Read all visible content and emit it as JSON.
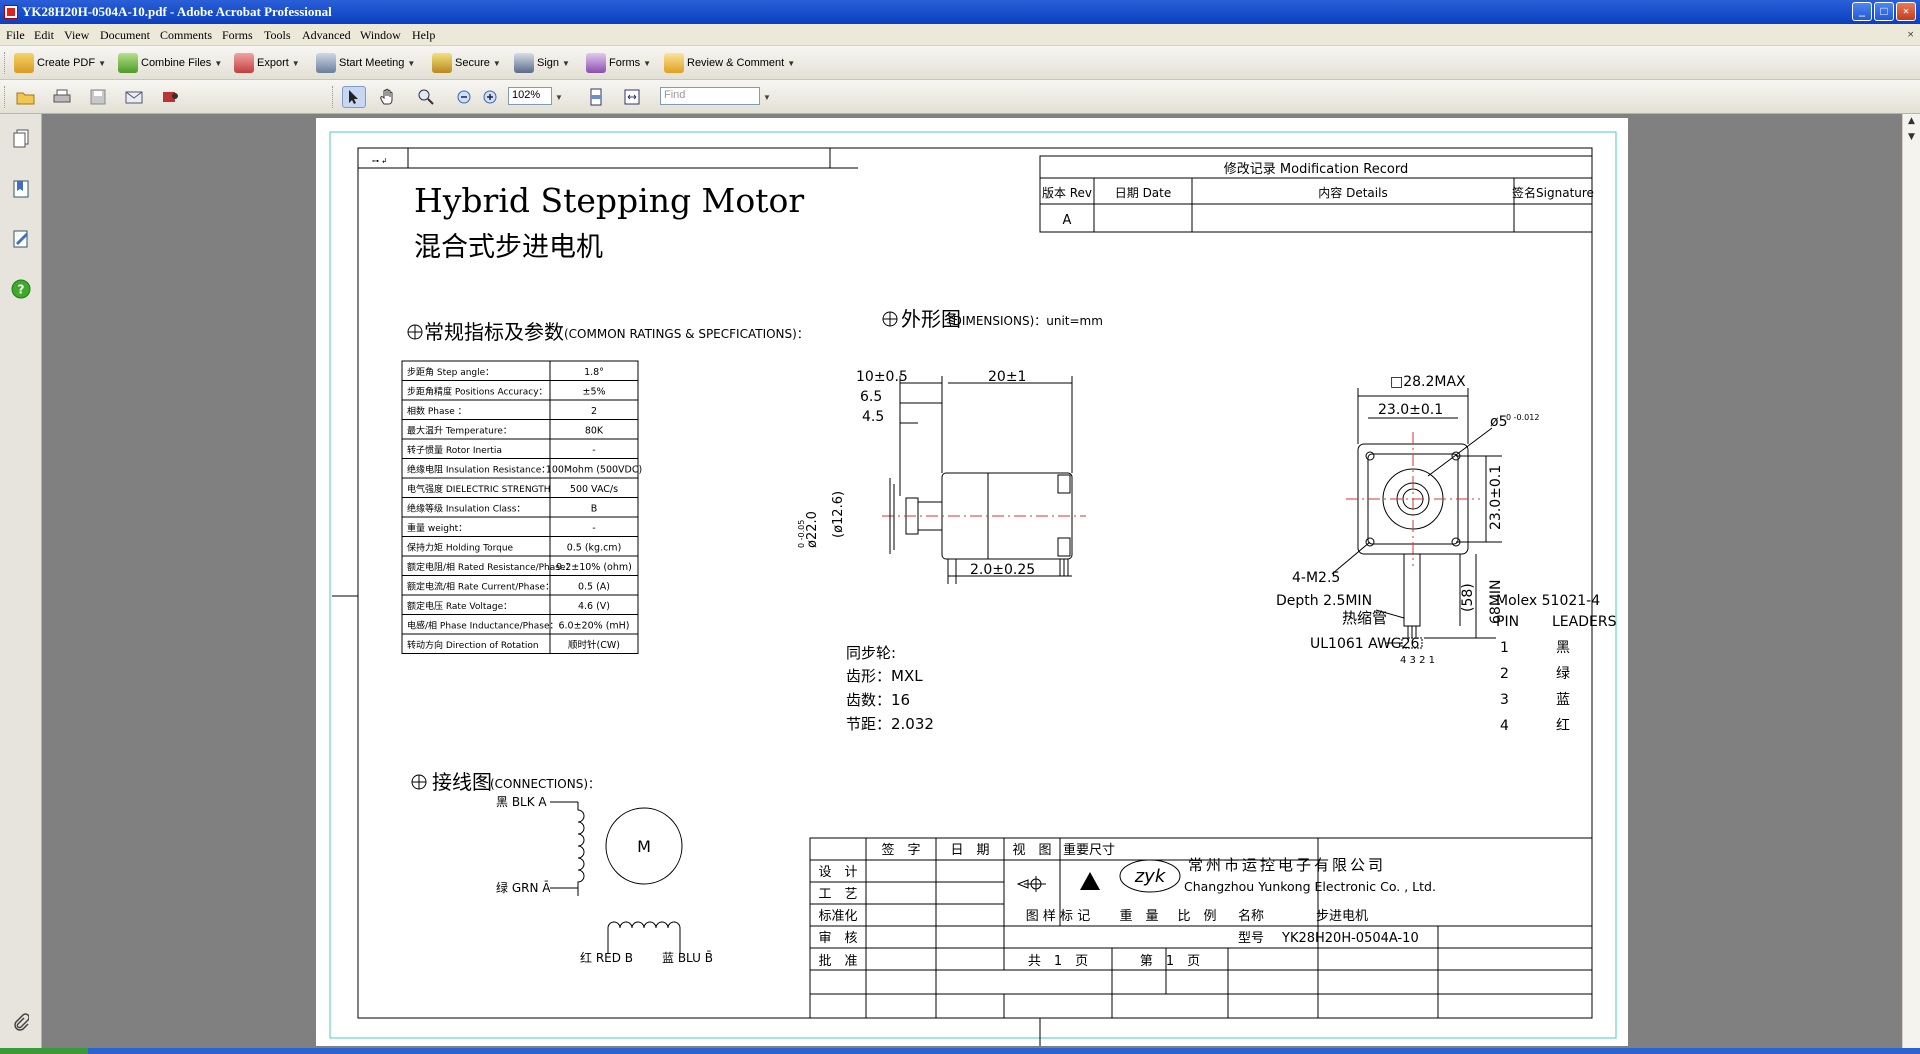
{
  "window": {
    "title": "YK28H20H-0504A-10.pdf - Adobe Acrobat Professional",
    "min": "_",
    "max": "□",
    "close": "×"
  },
  "menu": [
    "File",
    "Edit",
    "View",
    "Document",
    "Comments",
    "Forms",
    "Tools",
    "Advanced",
    "Window",
    "Help"
  ],
  "menu_close": "×",
  "toolbar1": {
    "create_pdf": "Create PDF",
    "combine": "Combine Files",
    "export": "Export",
    "meeting": "Start Meeting",
    "secure": "Secure",
    "sign": "Sign",
    "forms": "Forms",
    "review": "Review & Comment"
  },
  "toolbar2": {
    "zoom": "102%",
    "find_placeholder": "Find"
  },
  "drawing": {
    "title_en": "Hybrid Stepping Motor",
    "title_cn": "混合式步进电机",
    "mod_record": {
      "header": "修改记录 Modification Record",
      "cols": [
        "版本 Rev",
        "日期 Date",
        "内容 Details",
        "签名Signature"
      ],
      "row": [
        "A",
        "",
        "",
        ""
      ]
    },
    "specs_heading": "常规指标及参数",
    "specs_heading_en": "(COMMON RATINGS & SPECFICATIONS)：",
    "specs": [
      [
        "步距角 Step angle：",
        "1.8°"
      ],
      [
        "步距角精度 Positions Accuracy：",
        "±5%"
      ],
      [
        "相数 Phase ：",
        "2"
      ],
      [
        "最大温升 Temperature：",
        "80K"
      ],
      [
        "转子惯量 Rotor Inertia",
        "-"
      ],
      [
        "绝缘电阻 Insulation Resistance：",
        "100Mohm (500VDC)"
      ],
      [
        "电气强度 DIELECTRIC STRENGTH",
        "500 VAC/s"
      ],
      [
        "绝缘等级 Insulation Class：",
        "B"
      ],
      [
        "重量 weight：",
        "-"
      ],
      [
        "保持力矩  Holding Torque",
        "0.5 (kg.cm)"
      ],
      [
        "额定电阻/相 Rated Resistance/Phase：",
        "9.2±10% (ohm)"
      ],
      [
        "额定电流/相 Rate Current/Phase：",
        "0.5 (A)"
      ],
      [
        "额定电压 Rate Voltage：",
        "4.6 (V)"
      ],
      [
        "电感/相 Phase Inductance/Phase：",
        "6.0±20% (mH)"
      ],
      [
        "转动方向  Direction of Rotation",
        "顺时针(CW)"
      ]
    ],
    "dim_heading": "外形图",
    "dim_heading_en": "(DIMENSIONS)：unit=mm",
    "dims": {
      "d1": "10±0.5",
      "d2": "20±1",
      "d3": "6.5",
      "d4": "4.5",
      "d5": "2.0±0.25",
      "d6": "ø22.0",
      "d6tol": "0 -0.05",
      "d7": "(ø12.6)",
      "sq": "□28.2MAX",
      "hole": "23.0±0.1",
      "hole_v": "23.0±0.1",
      "shaft": "ø5",
      "shaft_tol": "0 -0.012",
      "screw": "4-M2.5",
      "depth": "Depth 2.5MIN",
      "tube": "热缩管",
      "wire": "UL1061 AWG26",
      "len1": "(58)",
      "len2": "68MIN",
      "pins": "4 3 2 1"
    },
    "pulley": [
      "同步轮:",
      "齿形：MXL",
      "齿数：16",
      "节距：2.032"
    ],
    "molex": {
      "title": "Molex 51021-4",
      "head": [
        "PIN",
        "LEADERS"
      ],
      "rows": [
        [
          "1",
          "黑"
        ],
        [
          "2",
          "绿"
        ],
        [
          "3",
          "蓝"
        ],
        [
          "4",
          "红"
        ]
      ]
    },
    "conn_heading": "接线图",
    "conn_heading_en": "(CONNECTIONS)：",
    "conn": {
      "blk": "黑 BLK A",
      "grn": "绿 GRN Ā",
      "red": "红 RED B",
      "blu": "蓝 BLU B̄",
      "m": "M"
    },
    "titleblock": {
      "h_sign": "签　字",
      "h_date": "日　期",
      "h_view": "视　图",
      "h_size": "重要尺寸",
      "design": "设　计",
      "process": "工　艺",
      "std": "标准化",
      "check": "审　核",
      "approve": "批　准",
      "sample": "图 样 标 记",
      "weight": "重　量",
      "scale": "比　例",
      "name_label": "名称",
      "name_val": "步进电机",
      "model_label": "型号",
      "model_val": "YK28H20H-0504A-10",
      "total": "共　1　页",
      "page": "第　1　页",
      "company_cn": "常州市运控电子有限公司",
      "company_en": "Changzhou Yunkong Electronic Co. , Ltd.",
      "logo": "zyk"
    },
    "corner_mark": "⊶ ↲"
  }
}
